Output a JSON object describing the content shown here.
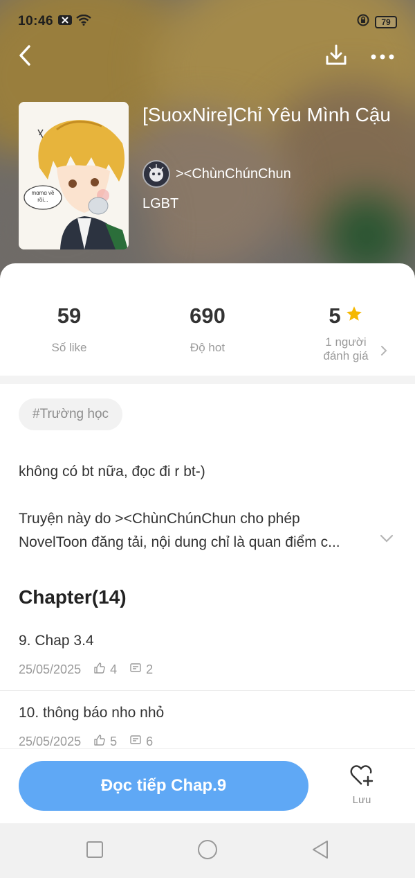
{
  "status_bar": {
    "time": "10:46",
    "battery": "79"
  },
  "header": {
    "back_icon": "chevron-left-icon",
    "download_icon": "download-icon",
    "more_icon": "more-icon"
  },
  "book": {
    "title": "[SuoxNire]Chỉ Yêu Mình Cậu",
    "author": "><ChùnChúnChun",
    "category": "LGBT",
    "cover_sticker_text": "mɑmɑ về rồi..."
  },
  "stats": {
    "likes": {
      "value": "59",
      "label": "Số like"
    },
    "hot": {
      "value": "690",
      "label": "Độ hot"
    },
    "rating": {
      "value": "5",
      "label_line1": "1 người",
      "label_line2": "đánh giá"
    }
  },
  "tag": "#Trường học",
  "description": {
    "text": "không có bt nữa, đọc đi r bt-)",
    "permission_line1": "Truyện này do ><ChùnChúnChun cho phép",
    "permission_line2": "NovelToon đăng tải, nội dung chỉ là quan điểm c..."
  },
  "chapters": {
    "heading": "Chapter(14)",
    "items": [
      {
        "title": "9. Chap 3.4",
        "date": "25/05/2025",
        "likes": "4",
        "comments": "2"
      },
      {
        "title": "10. thông báo nho nhỏ",
        "date": "25/05/2025",
        "likes": "5",
        "comments": "6"
      }
    ]
  },
  "actions": {
    "read_button": "Đọc tiếp Chap.9",
    "save_label": "Lưu"
  },
  "colors": {
    "accent": "#5fa8f5",
    "star": "#f5b800"
  }
}
